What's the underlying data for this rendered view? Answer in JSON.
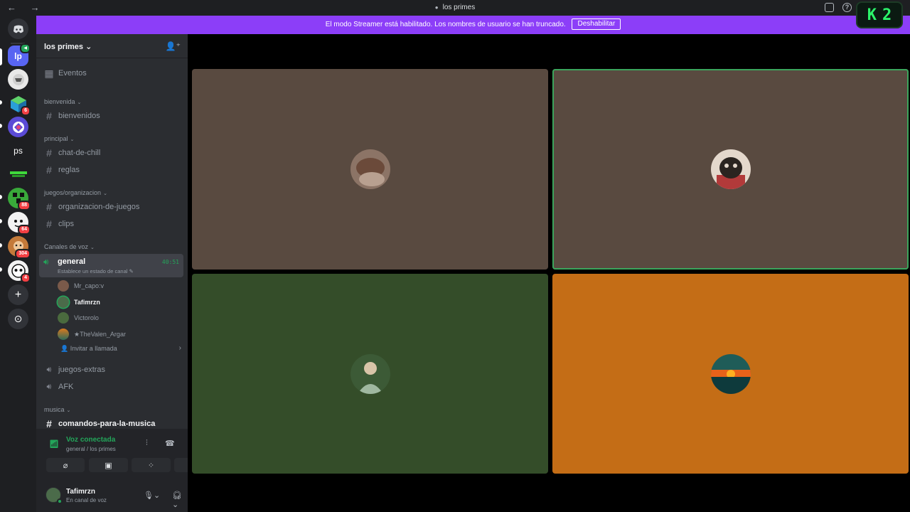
{
  "window": {
    "title": "los primes",
    "nav_arrows": "← →",
    "inbox_icon": "inbox-icon",
    "help_icon": "help-icon"
  },
  "banner": {
    "text": "El modo Streamer está habilitado. Los nombres de usuario se han truncado.",
    "button": "Deshabilitar"
  },
  "streamer_badge": {
    "k": "K",
    "count": "2"
  },
  "rail": {
    "home_icon": "discord-icon",
    "servers": [
      {
        "label": "lp",
        "color": "#5865f2",
        "badge": ""
      },
      {
        "label": "",
        "color": "#e8e8e8",
        "badge": ""
      },
      {
        "label": "",
        "color": "#2aa8d8",
        "badge": "6"
      },
      {
        "label": "",
        "color": "#5b4bd6",
        "badge": ""
      },
      {
        "label": "ps",
        "color": "#1e1f22",
        "badge": ""
      },
      {
        "label": "",
        "color": "#1e1f22",
        "badge": ""
      },
      {
        "label": "",
        "color": "#39a93a",
        "badge": "88"
      },
      {
        "label": "",
        "color": "#f2f2f2",
        "badge": "64"
      },
      {
        "label": "",
        "color": "#c47a3a",
        "badge": "304"
      },
      {
        "label": "",
        "color": "#f2f2f2",
        "badge": "4"
      }
    ],
    "add_server": "+",
    "discover": "⊙"
  },
  "sidebar": {
    "server_name": "los primes",
    "events": "Eventos",
    "categories": {
      "bienvenida": "bienvenida",
      "principal": "principal",
      "juegos": "juegos/organizacion",
      "voz": "Canales de voz",
      "musica": "musica"
    },
    "channels": {
      "bienvenidos": "bienvenidos",
      "chat": "chat-de-chill",
      "reglas": "reglas",
      "organizacion": "organizacion-de-juegos",
      "clips": "clips",
      "general": "general",
      "general_time": "40:51",
      "general_status": "Establece un estado de canal",
      "juegos_extras": "juegos-extras",
      "afk": "AFK",
      "comandos": "comandos-para-la-musica"
    },
    "members": [
      "Mr_capo:v",
      "Tafimrzn",
      "Victorolo",
      "★TheValen_Argar"
    ],
    "invite": "Invitar a llamada"
  },
  "voice_panel": {
    "title": "Voz conectada",
    "subtitle": "general / los primes"
  },
  "user": {
    "name": "Tafimrzn",
    "status": "En canal de voz"
  },
  "tiles": [
    {
      "user": "Mr_capo:v",
      "color": "#594a40",
      "speaking": false
    },
    {
      "user": "Tafimrzn",
      "color": "#594a40",
      "speaking": true
    },
    {
      "user": "Victorolo",
      "color": "#344d29",
      "speaking": false
    },
    {
      "user": "★TheValen_Argar",
      "color": "#c46d16",
      "speaking": false
    }
  ]
}
